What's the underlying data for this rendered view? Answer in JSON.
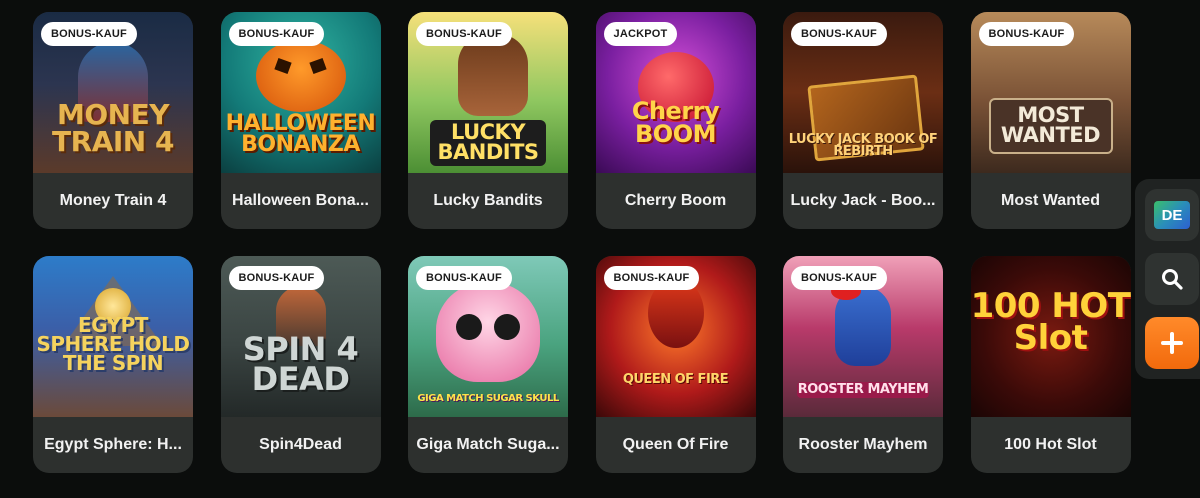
{
  "games": [
    {
      "name": "Money Train 4",
      "badge": "BONUS-KAUF",
      "art": "MONEY TRAIN 4"
    },
    {
      "name": "Halloween Bona...",
      "badge": "BONUS-KAUF",
      "art": "HALLOWEEN BONANZA"
    },
    {
      "name": "Lucky Bandits",
      "badge": "BONUS-KAUF",
      "art": "LUCKY BANDITS"
    },
    {
      "name": "Cherry Boom",
      "badge": "JACKPOT",
      "art": "Cherry BOOM"
    },
    {
      "name": "Lucky Jack - Boo...",
      "badge": "BONUS-KAUF",
      "art": "LUCKY JACK BOOK OF REBIRTH"
    },
    {
      "name": "Most Wanted",
      "badge": "BONUS-KAUF",
      "art": "MOST WANTED"
    },
    {
      "name": "Egypt Sphere: H...",
      "badge": "",
      "art": "EGYPT SPHERE HOLD THE SPIN"
    },
    {
      "name": "Spin4Dead",
      "badge": "BONUS-KAUF",
      "art": "SPIN 4 DEAD"
    },
    {
      "name": "Giga Match Suga...",
      "badge": "BONUS-KAUF",
      "art": "GIGA MATCH SUGAR SKULL"
    },
    {
      "name": "Queen Of Fire",
      "badge": "BONUS-KAUF",
      "art": "QUEEN OF FIRE"
    },
    {
      "name": "Rooster Mayhem",
      "badge": "BONUS-KAUF",
      "art": "ROOSTER MAYHEM"
    },
    {
      "name": "100 Hot Slot",
      "badge": "",
      "art": "100 HOT Slot"
    }
  ],
  "side": {
    "language": "DE",
    "search_icon": "search-icon",
    "add_icon": "plus-icon"
  },
  "colors": {
    "background": "#0b0d0c",
    "card": "#2d302e",
    "accent": "#f26a0c"
  }
}
